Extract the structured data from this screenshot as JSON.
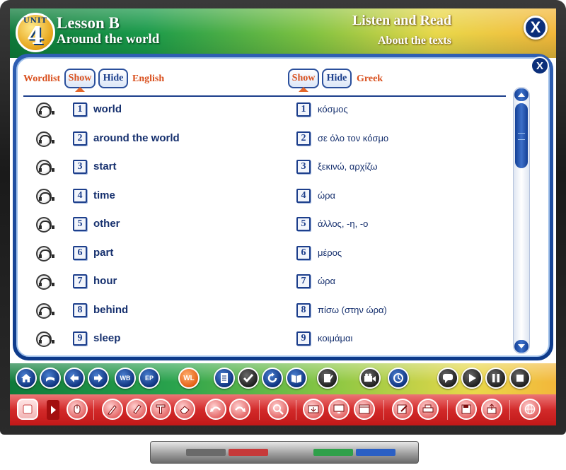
{
  "header": {
    "unit_label": "UNIT",
    "unit_number": "4",
    "lesson_title": "Lesson B",
    "lesson_subtitle": "Around the world",
    "section_title": "Listen and Read",
    "section_subtitle": "About the texts",
    "close_label": "X"
  },
  "panel": {
    "close_label": "X",
    "wordlist_label": "Wordlist",
    "english_show": "Show",
    "english_hide": "Hide",
    "english_label": "English",
    "greek_show": "Show",
    "greek_hide": "Hide",
    "greek_label": "Greek"
  },
  "words": [
    {
      "num": "1",
      "en": "world",
      "gr": "κόσμος"
    },
    {
      "num": "2",
      "en": "around the world",
      "gr": "σε όλο τον κόσμο"
    },
    {
      "num": "3",
      "en": "start",
      "gr": "ξεκινώ, αρχίζω"
    },
    {
      "num": "4",
      "en": "time",
      "gr": "ώρα"
    },
    {
      "num": "5",
      "en": "other",
      "gr": "άλλος, -η, -ο"
    },
    {
      "num": "6",
      "en": "part",
      "gr": "μέρος"
    },
    {
      "num": "7",
      "en": "hour",
      "gr": "ώρα"
    },
    {
      "num": "8",
      "en": "behind",
      "gr": "πίσω (στην ώρα)"
    },
    {
      "num": "9",
      "en": "sleep",
      "gr": "κοιμάμαι"
    }
  ],
  "toolbar1": {
    "home": "home-icon",
    "back": "back-icon",
    "prev": "arrow-left-icon",
    "next": "arrow-right-icon",
    "wb_label": "WB",
    "ep_label": "EP",
    "wl_label": "WL",
    "doc": "document-icon",
    "check": "check-icon",
    "reload": "reload-icon",
    "book": "book-icon",
    "notes": "notes-icon",
    "video": "video-icon",
    "clock": "clock-icon",
    "chat": "chat-icon",
    "play": "play-icon",
    "pause": "pause-icon",
    "stop": "stop-icon"
  },
  "colors": {
    "accent_orange": "#d9501e",
    "navy": "#1d3f8c",
    "header_green": "#0e7a3a",
    "toolbar_red": "#c11818"
  }
}
